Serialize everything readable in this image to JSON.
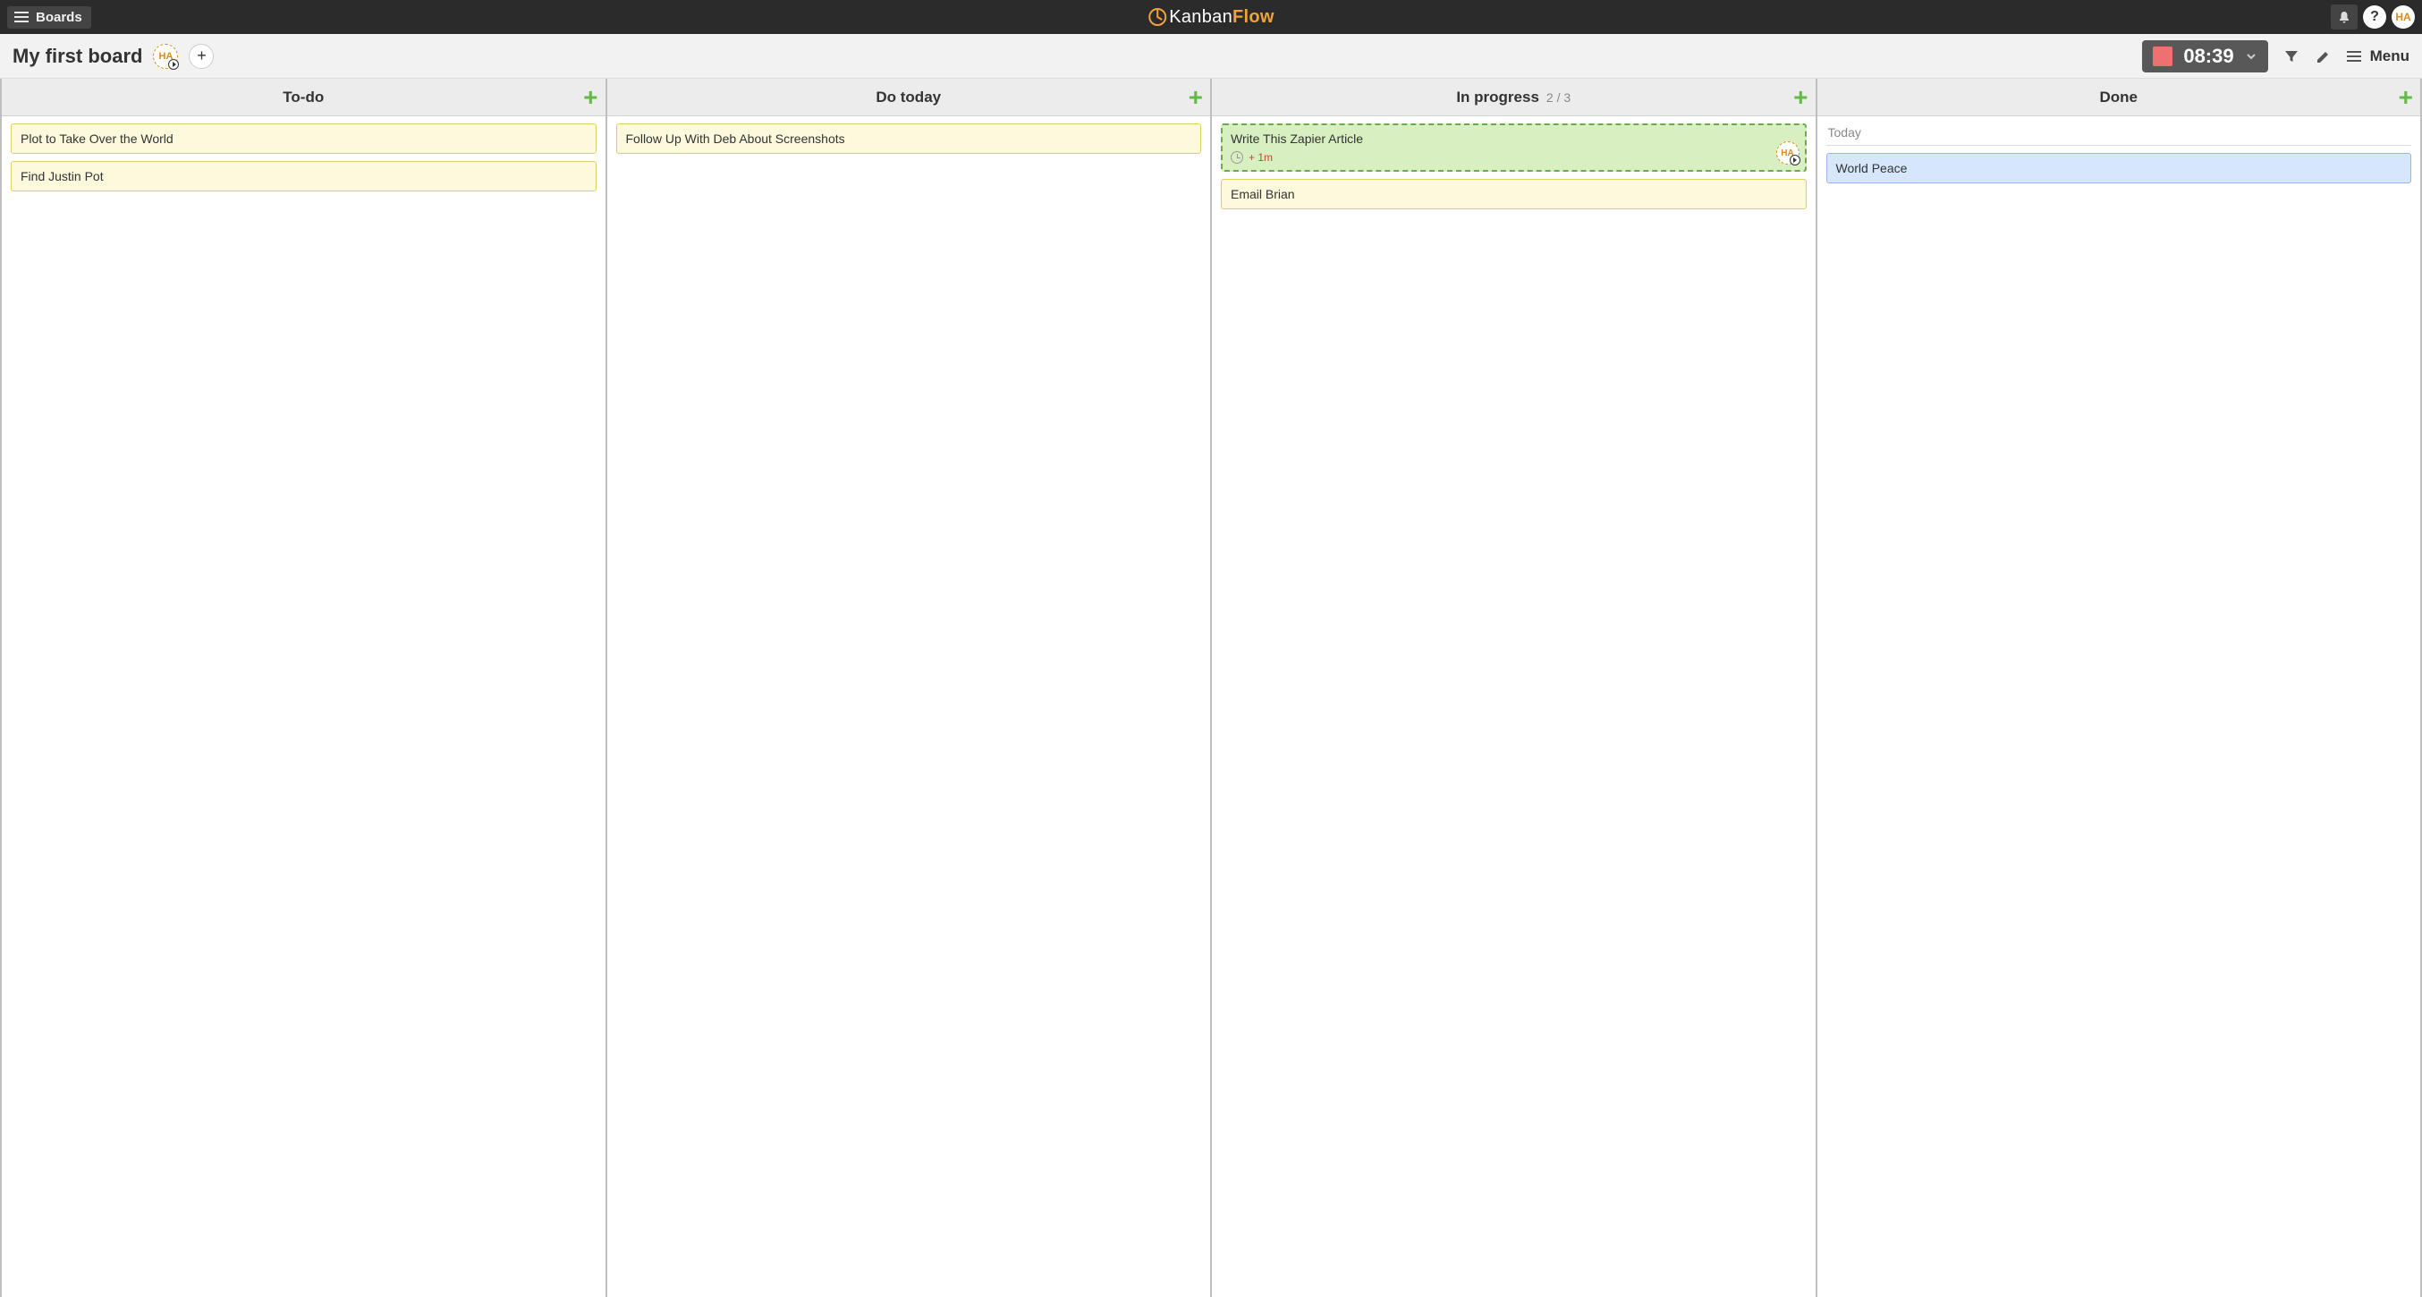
{
  "topbar": {
    "boards_label": "Boards",
    "logo_prefix": "Kanban",
    "logo_suffix": "Flow",
    "avatar_initials": "HA"
  },
  "board_header": {
    "title": "My first board",
    "member_initials": "HA",
    "timer": "08:39",
    "menu_label": "Menu"
  },
  "columns": [
    {
      "title": "To-do",
      "wip": "",
      "swimlane": "",
      "cards": [
        {
          "title": "Plot to Take Over the World",
          "style": "yellow"
        },
        {
          "title": "Find Justin Pot",
          "style": "yellow"
        }
      ]
    },
    {
      "title": "Do today",
      "wip": "",
      "swimlane": "",
      "cards": [
        {
          "title": "Follow Up With Deb About Screenshots",
          "style": "yellow"
        }
      ]
    },
    {
      "title": "In progress",
      "wip": "2 / 3",
      "swimlane": "",
      "cards": [
        {
          "title": "Write This Zapier Article",
          "style": "active",
          "time": "+ 1m",
          "assignee": "HA"
        },
        {
          "title": "Email Brian",
          "style": "yellow"
        }
      ]
    },
    {
      "title": "Done",
      "wip": "",
      "swimlane": "Today",
      "cards": [
        {
          "title": "World Peace",
          "style": "blue"
        }
      ]
    }
  ]
}
